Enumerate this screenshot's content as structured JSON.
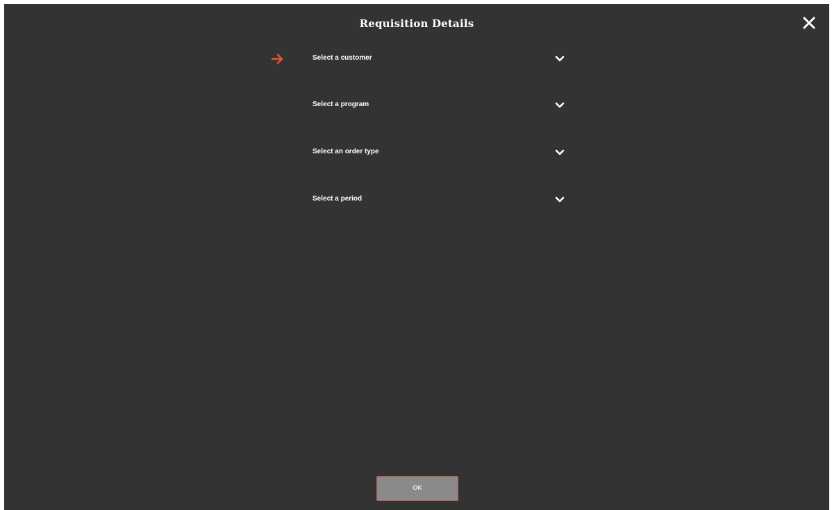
{
  "dialog": {
    "title": "Requisition Details",
    "close_icon": "close-icon"
  },
  "fields": [
    {
      "label": "Select a customer",
      "active": true,
      "icon": "chevron-down-icon"
    },
    {
      "label": "Select a program",
      "active": false,
      "icon": "chevron-down-icon"
    },
    {
      "label": "Select an order type",
      "active": false,
      "icon": "chevron-down-icon"
    },
    {
      "label": "Select a period",
      "active": false,
      "icon": "chevron-down-icon"
    }
  ],
  "ok_button": {
    "label": "OK"
  },
  "colors": {
    "background": "#333333",
    "accent": "#e5533d",
    "button_bg": "#8a8a8a",
    "button_border": "#c15b47"
  }
}
